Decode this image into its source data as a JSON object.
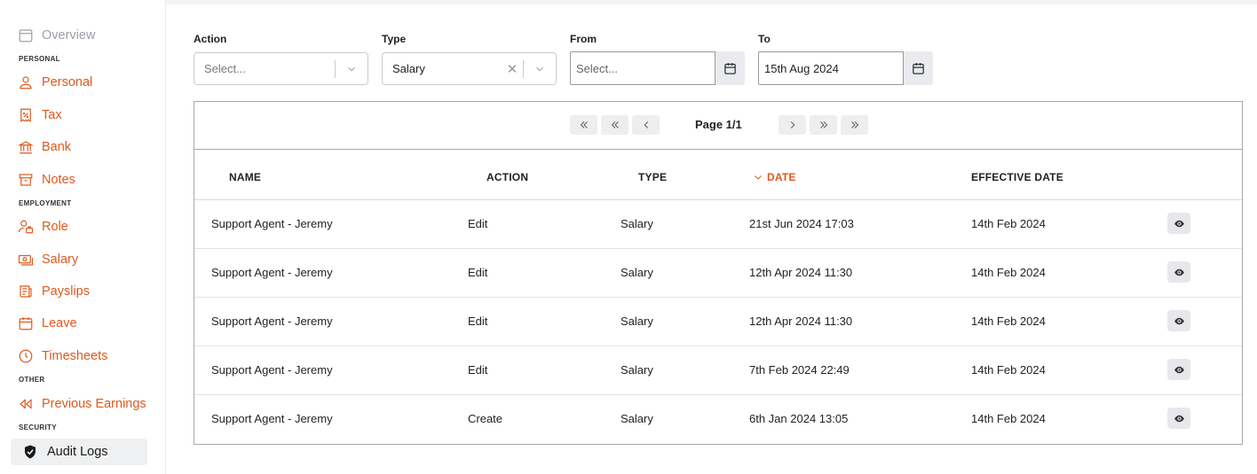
{
  "sidebar": {
    "overview": "Overview",
    "sections": {
      "personal": "PERSONAL",
      "employment": "EMPLOYMENT",
      "other": "OTHER",
      "security": "SECURITY"
    },
    "items": {
      "personal": "Personal",
      "tax": "Tax",
      "bank": "Bank",
      "notes": "Notes",
      "role": "Role",
      "salary": "Salary",
      "payslips": "Payslips",
      "leave": "Leave",
      "timesheets": "Timesheets",
      "previous_earnings": "Previous Earnings",
      "audit_logs": "Audit Logs"
    },
    "accent_color": "#dd5a1e"
  },
  "filters": {
    "action": {
      "label": "Action",
      "placeholder": "Select..."
    },
    "type": {
      "label": "Type",
      "value": "Salary"
    },
    "from": {
      "label": "From",
      "placeholder": "Select..."
    },
    "to": {
      "label": "To",
      "value": "15th Aug 2024"
    }
  },
  "pagination": {
    "page_text": "Page 1/1"
  },
  "table": {
    "columns": {
      "name": "NAME",
      "action": "ACTION",
      "type": "TYPE",
      "date": "DATE",
      "effective_date": "EFFECTIVE DATE"
    },
    "sorted_column": "date",
    "rows": [
      {
        "name": "Support Agent - Jeremy",
        "action": "Edit",
        "type": "Salary",
        "date": "21st Jun 2024 17:03",
        "effective_date": "14th Feb 2024"
      },
      {
        "name": "Support Agent - Jeremy",
        "action": "Edit",
        "type": "Salary",
        "date": "12th Apr 2024 11:30",
        "effective_date": "14th Feb 2024"
      },
      {
        "name": "Support Agent - Jeremy",
        "action": "Edit",
        "type": "Salary",
        "date": "12th Apr 2024 11:30",
        "effective_date": "14th Feb 2024"
      },
      {
        "name": "Support Agent - Jeremy",
        "action": "Edit",
        "type": "Salary",
        "date": "7th Feb 2024 22:49",
        "effective_date": "14th Feb 2024"
      },
      {
        "name": "Support Agent - Jeremy",
        "action": "Create",
        "type": "Salary",
        "date": "6th Jan 2024 13:05",
        "effective_date": "14th Feb 2024"
      }
    ]
  }
}
